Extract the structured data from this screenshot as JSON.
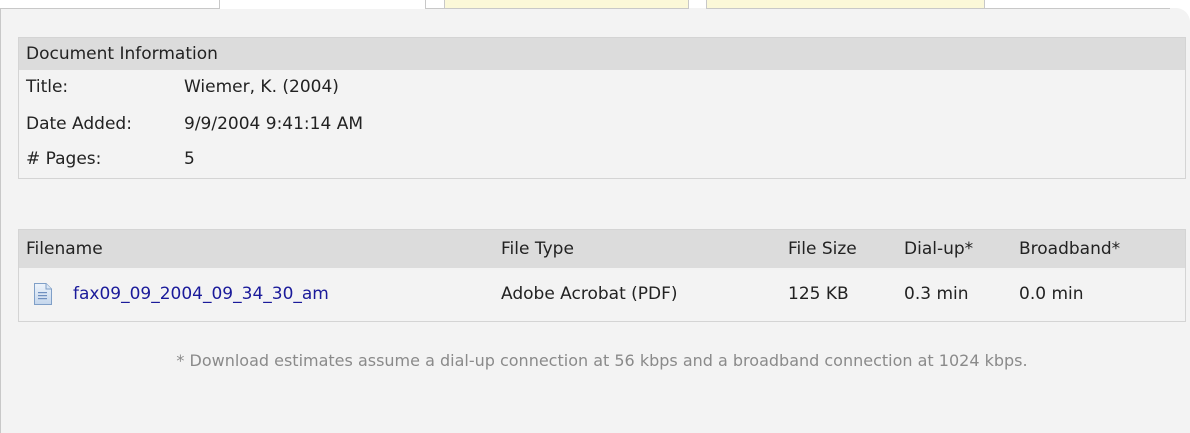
{
  "tabs": [
    {
      "label": ""
    },
    {
      "label": ""
    },
    {
      "label": ""
    }
  ],
  "document_info": {
    "header": "Document Information",
    "rows": [
      {
        "label": "Title:",
        "value": "Wiemer, K. (2004)"
      },
      {
        "label": "Date Added:",
        "value": "9/9/2004 9:41:14 AM"
      },
      {
        "label": "# Pages:",
        "value": "5"
      }
    ]
  },
  "files": {
    "columns": {
      "filename": "Filename",
      "file_type": "File Type",
      "file_size": "File Size",
      "dialup": "Dial-up*",
      "broadband": "Broadband*"
    },
    "rows": [
      {
        "icon": "document-icon",
        "filename": "fax09_09_2004_09_34_30_am",
        "file_type": "Adobe Acrobat (PDF)",
        "file_size": "125 KB",
        "dialup": "0.3 min",
        "broadband": "0.0 min"
      }
    ]
  },
  "footnote": "* Download estimates assume a dial-up connection at 56 kbps and a broadband connection at 1024 kbps.",
  "colors": {
    "panel_bg": "#f3f3f3",
    "header_bg": "#dcdcdc",
    "inactive_tab_bg": "#fbf8d8",
    "link": "#1a1a9a",
    "footnote_text": "#8a8a8a"
  }
}
